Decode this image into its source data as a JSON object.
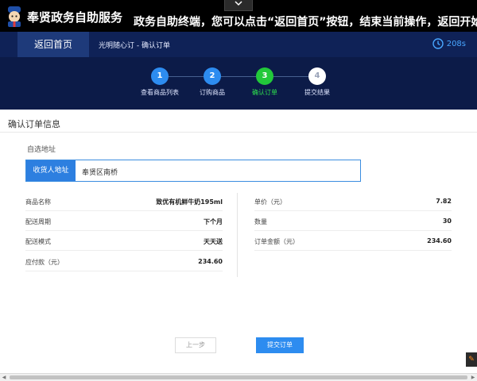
{
  "topbar": {
    "collapse_icon": "chevron-down-icon",
    "app_title": "奉贤政务自助服务",
    "marquee": "政务自助终端，您可以点击“返回首页”按钮，结束当前操作，返回开始页"
  },
  "header": {
    "home_button": "返回首页",
    "breadcrumb": "光明随心订 - 确认订单",
    "timer": "208s",
    "timer_icon": "clock-icon"
  },
  "steps": [
    {
      "num": "1",
      "label": "查看商品列表",
      "state": "done",
      "color": "#2d8cf0"
    },
    {
      "num": "2",
      "label": "订购商品",
      "state": "done",
      "color": "#2d8cf0"
    },
    {
      "num": "3",
      "label": "确认订单",
      "state": "active",
      "color": "#22c93a"
    },
    {
      "num": "4",
      "label": "提交结果",
      "state": "pending",
      "color": "#ffffff"
    }
  ],
  "content": {
    "section_title": "确认订单信息",
    "address_caption": "自选地址",
    "address_tag": "收货人地址",
    "address_value": "奉贤区南桥",
    "left_info": [
      {
        "label": "商品名称",
        "value": "致优有机鲜牛奶195ml"
      },
      {
        "label": "配送周期",
        "value": "下个月"
      },
      {
        "label": "配送模式",
        "value": "天天送"
      },
      {
        "label": "应付款（元）",
        "value": "234.60"
      }
    ],
    "right_info": [
      {
        "label": "单价（元）",
        "value": "7.82"
      },
      {
        "label": "数量",
        "value": "30"
      },
      {
        "label": "订单金额（元）",
        "value": "234.60"
      }
    ],
    "prev_button": "上一步",
    "submit_button": "提交订单"
  },
  "widget": {
    "glyph": "✎",
    "icon": "edit-icon"
  },
  "scrollbar": {
    "left": "◀",
    "right": "▶"
  },
  "colors": {
    "navy": "#0c1b48",
    "accent": "#2d8cf0",
    "active_step": "#22c93a"
  }
}
